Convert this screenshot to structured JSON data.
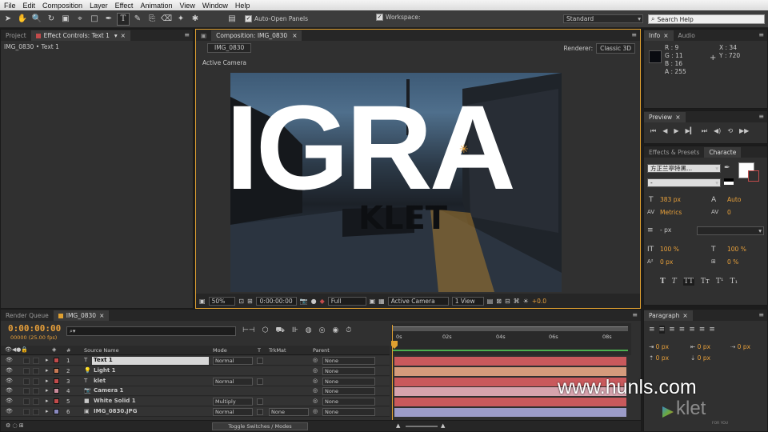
{
  "menu": [
    "File",
    "Edit",
    "Composition",
    "Layer",
    "Effect",
    "Animation",
    "View",
    "Window",
    "Help"
  ],
  "toolbar": {
    "auto_open_label": "Auto-Open Panels",
    "workspace_label": "Workspace:",
    "workspace_value": "Standard",
    "search_placeholder": "Search Help"
  },
  "project_panel": {
    "tab_project": "Project",
    "tab_effect": "Effect Controls: Text 1",
    "breadcrumb": "IMG_0830 • Text 1"
  },
  "composition": {
    "tab": "Composition: IMG_0830",
    "subtab": "IMG_0830",
    "renderer_label": "Renderer:",
    "renderer_value": "Classic 3D",
    "camera_label": "Active Camera",
    "overlay_text": "IGRA",
    "shadow_text": "KLET",
    "zoom": "50%",
    "timecode": "0:00:00:00",
    "resolution": "Full",
    "view_camera": "Active Camera",
    "view_count": "1 View",
    "exposure": "+0.0"
  },
  "info": {
    "tab_info": "Info",
    "tab_audio": "Audio",
    "r": "R : 9",
    "g": "G : 11",
    "b": "B : 16",
    "a": "A : 255",
    "x": "X : 34",
    "y": "Y : 720"
  },
  "preview": {
    "tab": "Preview"
  },
  "character": {
    "tab_effects": "Effects & Presets",
    "tab_char": "Characte",
    "font": "方正兰亭特黑...",
    "style": "-",
    "size": "383 px",
    "leading": "Auto",
    "kerning": "Metrics",
    "tracking": "0",
    "stroke": "- px",
    "vscale": "100 %",
    "hscale": "100 %",
    "baseline": "0 px",
    "tsume": "0 %"
  },
  "paragraph": {
    "tab": "Paragraph",
    "v1": "0 px",
    "v2": "0 px",
    "v3": "0 px",
    "v4": "0 px",
    "v5": "0 px"
  },
  "timeline": {
    "render_tab": "Render Queue",
    "comp_tab": "IMG_0830",
    "timecode": "0:00:00:00",
    "frame_info": "00000 (25.00 fps)",
    "search_placeholder": "",
    "col_source": "Source Name",
    "col_mode": "Mode",
    "col_t": "T",
    "col_trkmat": "TrkMat",
    "col_parent": "Parent",
    "ruler": [
      "0s",
      "02s",
      "04s",
      "06s",
      "08s"
    ],
    "toggle_label": "Toggle Switches / Modes",
    "layers": [
      {
        "num": "1",
        "type": "T",
        "name": "Text 1",
        "mode": "Normal",
        "trk": "",
        "parent": "None",
        "color": "#c24b4b",
        "bar": "#c9595c"
      },
      {
        "num": "2",
        "type": "💡",
        "name": "Light 1",
        "mode": "",
        "trk": "",
        "parent": "None",
        "color": "#c97a55",
        "bar": "#d59b7c"
      },
      {
        "num": "3",
        "type": "T",
        "name": "klet",
        "mode": "Normal",
        "trk": "",
        "parent": "None",
        "color": "#c24b4b",
        "bar": "#c9595c"
      },
      {
        "num": "4",
        "type": "📷",
        "name": "Camera 1",
        "mode": "",
        "trk": "",
        "parent": "None",
        "color": "#c98a9a",
        "bar": "#d6a3ad"
      },
      {
        "num": "5",
        "type": "■",
        "name": "White Solid 1",
        "mode": "Multiply",
        "trk": "",
        "parent": "None",
        "color": "#c24b4b",
        "bar": "#c9595c"
      },
      {
        "num": "6",
        "type": "▣",
        "name": "IMG_0830.JPG",
        "mode": "Normal",
        "trk": "None",
        "parent": "None",
        "color": "#8a8ac0",
        "bar": "#9c9cc8"
      }
    ]
  },
  "watermark": "www.hunls.com",
  "logo": "klet",
  "logo_sub": "FOR YOU"
}
